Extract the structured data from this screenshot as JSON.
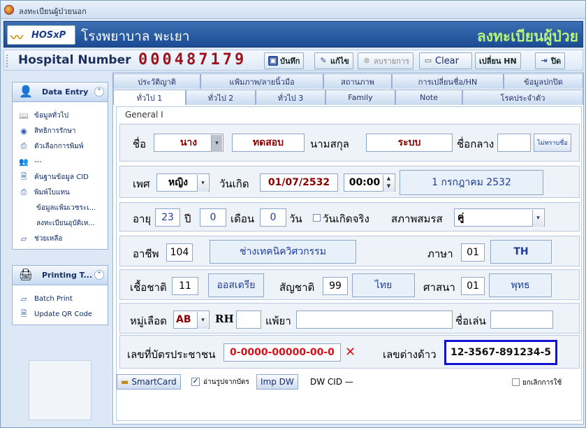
{
  "window": {
    "title": "ลงทะเบียนผู้ป่วยนอก"
  },
  "banner": {
    "logo_text": "HOSxP",
    "hospital": "โรงพยาบาล พะเยา",
    "page_title": "ลงทะเบียนผู้ป่วย"
  },
  "toolbar": {
    "hn_label": "Hospital Number",
    "hn_value": "000487179",
    "save": "บันทึก",
    "edit": "แก้ไข",
    "delete": "ลบรายการ",
    "clear": "Clear",
    "change_hn": "เปลี่ยน HN",
    "close": "ปิด"
  },
  "sidebar": {
    "data_entry": {
      "title": "Data Entry",
      "items": [
        "ข้อมูลทั่วไป",
        "สิทธิการรักษา",
        "ตัวเลือกการพิมพ์",
        "---",
        "ค้นฐานข้อมูล CID",
        "พิมพ์ใบแทน",
        "ข้อมูลแฟ้มเวชระเ...",
        "ลงทะเบียนอุบัติเห...",
        "ช่วยเหลือ"
      ]
    },
    "printing": {
      "title": "Printing T...",
      "items": [
        "Batch Print",
        "Update QR Code"
      ]
    }
  },
  "tabs_top": [
    "ประวัติญาติ",
    "แฟ้มภาพ/ลายนิ้วมือ",
    "สถานภาพ",
    "การเปลี่ยนชื่อ/HN",
    "ข้อมูลปกปิด"
  ],
  "tabs_bottom": [
    "ทั่วไป 1",
    "ทั่วไป 2",
    "ทั่วไป 3",
    "Family",
    "Note",
    "โรคประจำตัว"
  ],
  "group_label": "General I",
  "form": {
    "name_label": "ชื่อ",
    "prefix": "นาง",
    "first_name": "ทดสอบ",
    "surname_label": "นามสกุล",
    "surname": "ระบบ",
    "middle_label": "ชื่อกลาง",
    "middle": "",
    "unknown_name_btn": "ไม่ทราบชื่อ",
    "sex_label": "เพศ",
    "sex": "หญิง",
    "dob_label": "วันเกิด",
    "dob": "01/07/2532",
    "time": "00:00",
    "dob_text": "1 กรกฎาคม 2532",
    "age_label": "อายุ",
    "age_y": "23",
    "year_label": "ปี",
    "age_m": "0",
    "month_label": "เดือน",
    "age_d": "0",
    "day_label": "วัน",
    "real_dob_label": "วันเกิดจริง",
    "marital_label": "สภาพสมรส",
    "marital": "คู่",
    "occupation_label": "อาชีพ",
    "occupation_code": "104",
    "occupation": "ช่างเทคนิควิศวกรรม",
    "language_label": "ภาษา",
    "language_code": "01",
    "language": "TH",
    "race_label": "เชื้อชาติ",
    "race_code": "11",
    "race": "ออสเตรีย",
    "nationality_label": "สัญชาติ",
    "nationality_code": "99",
    "nationality": "ไทย",
    "religion_label": "ศาสนา",
    "religion_code": "01",
    "religion": "พุทธ",
    "blood_label": "หมู่เลือด",
    "blood": "AB",
    "rh_label": "RH",
    "rh": "",
    "allergy_label": "แพ้ยา",
    "allergy": "",
    "nickname_label": "ชื่อเล่น",
    "nickname": "",
    "cid_label": "เลขที่บัตรประชาชน",
    "cid": "0-0000-00000-00-0",
    "foreign_label": "เลขต่างด้าว",
    "foreign": "12-3567-891234-5"
  },
  "bottom": {
    "smartcard": "SmartCard",
    "read_photo": "อ่านรูปจากบัตร",
    "imp_dw": "Imp DW",
    "dw_cid": "DW CID —",
    "cancel_use": "ยกเลิกการใช้"
  }
}
